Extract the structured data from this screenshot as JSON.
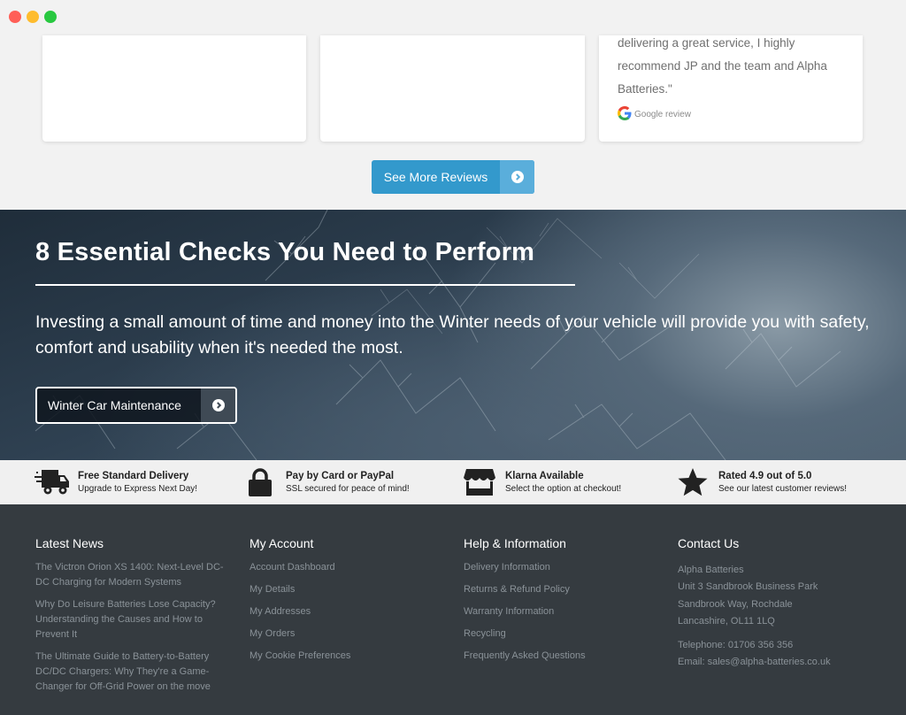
{
  "reviews": {
    "review_text": "delivering a great service, I highly recommend JP and the team and Alpha Batteries.\"",
    "source_label": "Google review",
    "see_more_label": "See More Reviews"
  },
  "hero": {
    "title": "8 Essential Checks You Need to Perform",
    "body": "Investing a small amount of time and money into the Winter needs of your vehicle will provide you with safety, comfort and usability when it's needed the most.",
    "button_label": "Winter Car Maintenance"
  },
  "features": [
    {
      "icon": "delivery-truck-icon",
      "title": "Free Standard Delivery",
      "subtitle": "Upgrade to Express Next Day!"
    },
    {
      "icon": "padlock-icon",
      "title": "Pay by Card or PayPal",
      "subtitle": "SSL secured for peace of mind!"
    },
    {
      "icon": "storefront-icon",
      "title": "Klarna Available",
      "subtitle": "Select the option at checkout!"
    },
    {
      "icon": "star-icon",
      "title": "Rated 4.9 out of 5.0",
      "subtitle": "See our latest customer reviews!"
    }
  ],
  "footer": {
    "latest_news": {
      "heading": "Latest News",
      "links": [
        "The Victron Orion XS 1400: Next-Level DC-DC Charging for Modern Systems",
        "Why Do Leisure Batteries Lose Capacity? Understanding the Causes and How to Prevent It",
        "The Ultimate Guide to Battery-to-Battery DC/DC Chargers: Why They're a Game-Changer for Off-Grid Power on the move"
      ]
    },
    "my_account": {
      "heading": "My Account",
      "links": [
        "Account Dashboard",
        "My Details",
        "My Addresses",
        "My Orders",
        "My Cookie Preferences"
      ]
    },
    "help": {
      "heading": "Help & Information",
      "links": [
        "Delivery Information",
        "Returns & Refund Policy",
        "Warranty Information",
        "Recycling",
        "Frequently Asked Questions"
      ]
    },
    "contact": {
      "heading": "Contact Us",
      "address": [
        "Alpha Batteries",
        "Unit 3 Sandbrook Business Park",
        "Sandbrook Way, Rochdale",
        "Lancashire, OL11 1LQ"
      ],
      "telephone": "Telephone: 01706 356 356",
      "email": "Email: sales@alpha-batteries.co.uk"
    }
  },
  "colors": {
    "accent": "#3399cc",
    "footer_bg": "#353b40",
    "features_bg": "#f0f0f0"
  }
}
